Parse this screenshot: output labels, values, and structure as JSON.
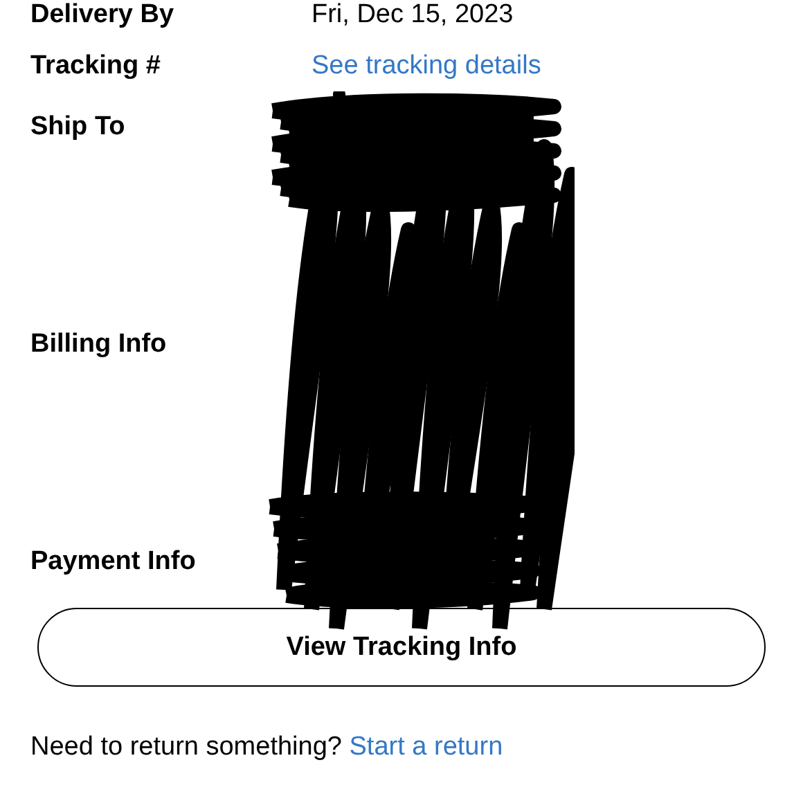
{
  "details": [
    {
      "label": "Delivery By",
      "value": "Fri, Dec 15, 2023",
      "kind": "text"
    },
    {
      "label": "Tracking #",
      "value": "See tracking details",
      "kind": "link"
    },
    {
      "label": "Ship To",
      "kind": "redacted"
    },
    {
      "label": "Billing Info",
      "kind": "redacted"
    },
    {
      "label": "Payment Info",
      "kind": "redacted"
    }
  ],
  "button": {
    "label": "View Tracking Info"
  },
  "footer": {
    "text": "Need to return something?",
    "link": "Start a return"
  }
}
